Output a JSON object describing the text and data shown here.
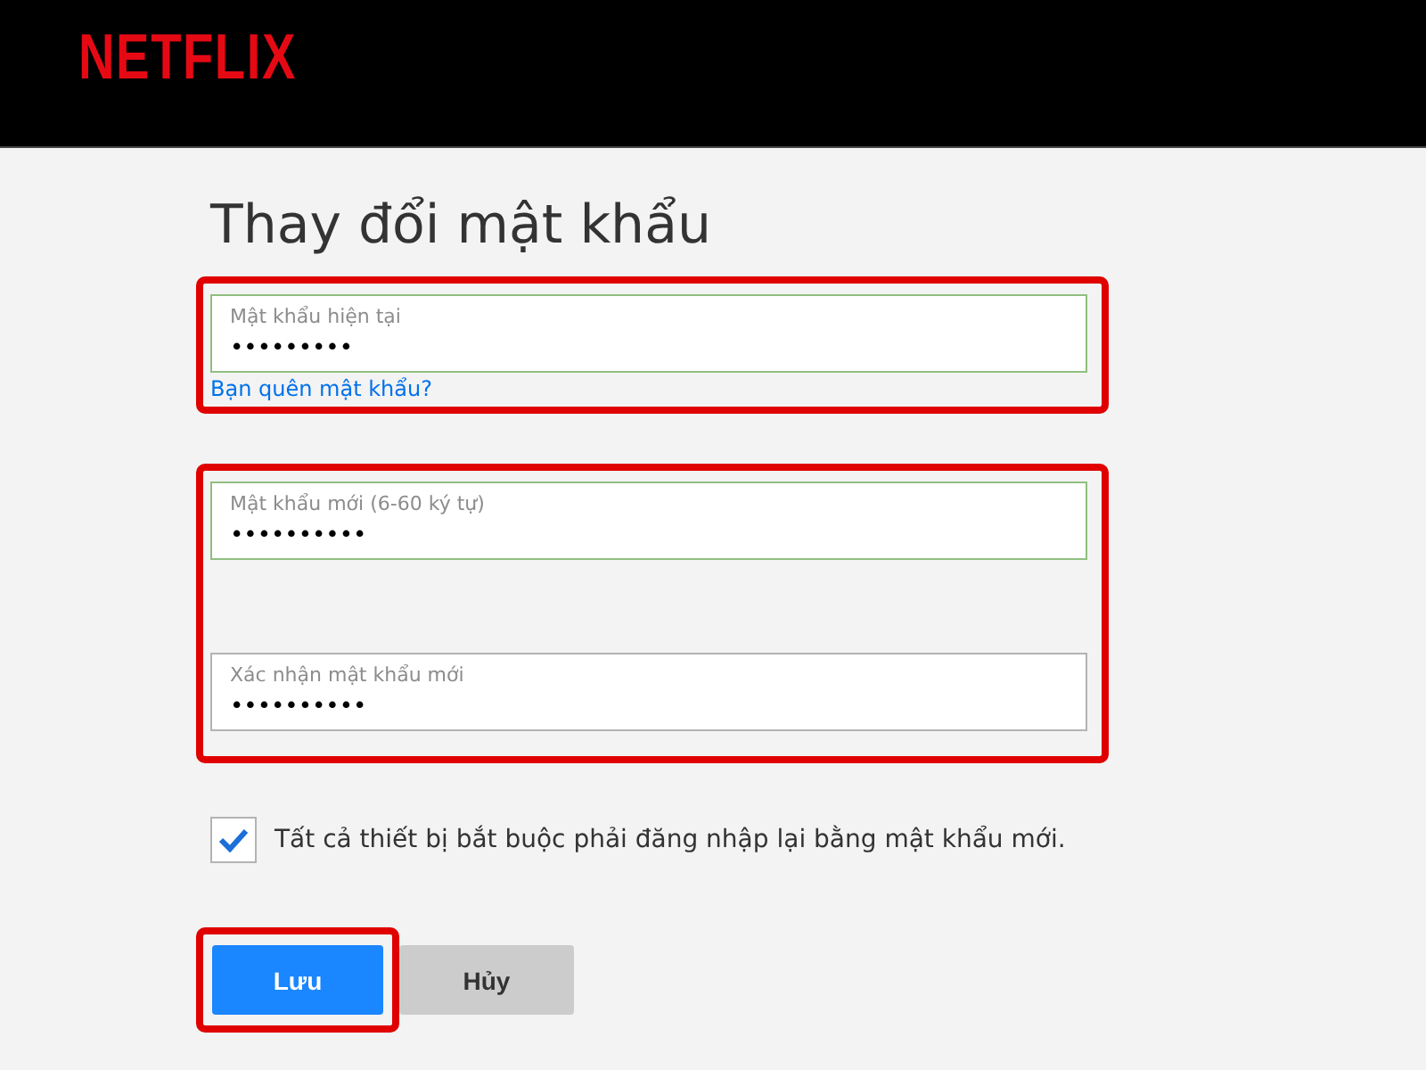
{
  "header": {
    "logo": "NETFLIX"
  },
  "title": "Thay đổi mật khẩu",
  "groups": [
    {
      "highlighted": true,
      "fields": [
        {
          "label": "Mật khẩu hiện tại",
          "value": "•••••••••",
          "valid": true
        }
      ],
      "link": "Bạn quên mật khẩu?"
    },
    {
      "highlighted": true,
      "fields": [
        {
          "label": "Mật khẩu mới (6-60 ký tự)",
          "value": "••••••••••",
          "valid": true
        },
        {
          "label": "Xác nhận mật khẩu mới",
          "value": "••••••••••",
          "valid": false
        }
      ]
    }
  ],
  "checkbox": {
    "label": "Tất cả thiết bị bắt buộc phải đăng nhập lại bằng mật khẩu mới.",
    "checked": true
  },
  "buttons": [
    {
      "label": "Lưu",
      "kind": "primary",
      "highlighted": true
    },
    {
      "label": "Hủy",
      "kind": "secondary",
      "highlighted": false
    }
  ]
}
